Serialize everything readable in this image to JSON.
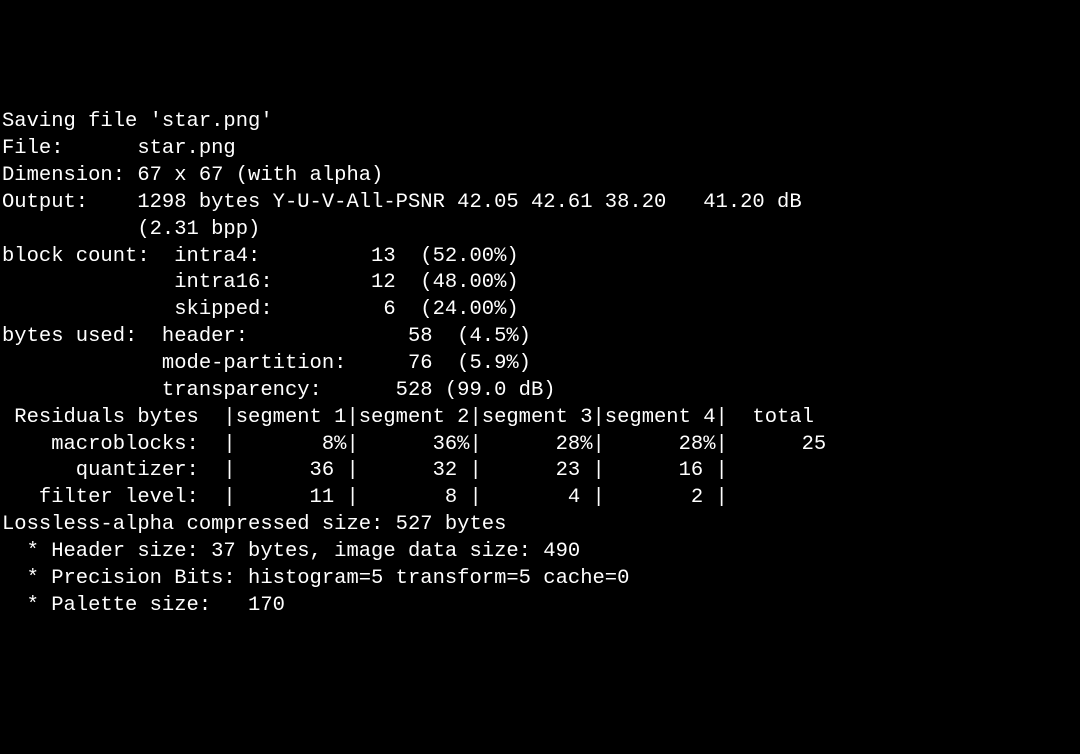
{
  "lines": {
    "l01": "Saving file 'star.png'",
    "l02": "File:      star.png",
    "l03": "Dimension: 67 x 67 (with alpha)",
    "l04": "Output:    1298 bytes Y-U-V-All-PSNR 42.05 42.61 38.20   41.20 dB",
    "l05": "           (2.31 bpp)",
    "l06": "block count:  intra4:         13  (52.00%)",
    "l07": "              intra16:        12  (48.00%)",
    "l08": "              skipped:         6  (24.00%)",
    "l09": "bytes used:  header:             58  (4.5%)",
    "l10": "             mode-partition:     76  (5.9%)",
    "l11": "             transparency:      528 (99.0 dB)",
    "l12": " Residuals bytes  |segment 1|segment 2|segment 3|segment 4|  total",
    "l13": "    macroblocks:  |       8%|      36%|      28%|      28%|      25",
    "l14": "      quantizer:  |      36 |      32 |      23 |      16 |",
    "l15": "   filter level:  |      11 |       8 |       4 |       2 |",
    "l16": "Lossless-alpha compressed size: 527 bytes",
    "l17": "  * Header size: 37 bytes, image data size: 490",
    "l18": "  * Precision Bits: histogram=5 transform=5 cache=0",
    "l19": "  * Palette size:   170"
  }
}
